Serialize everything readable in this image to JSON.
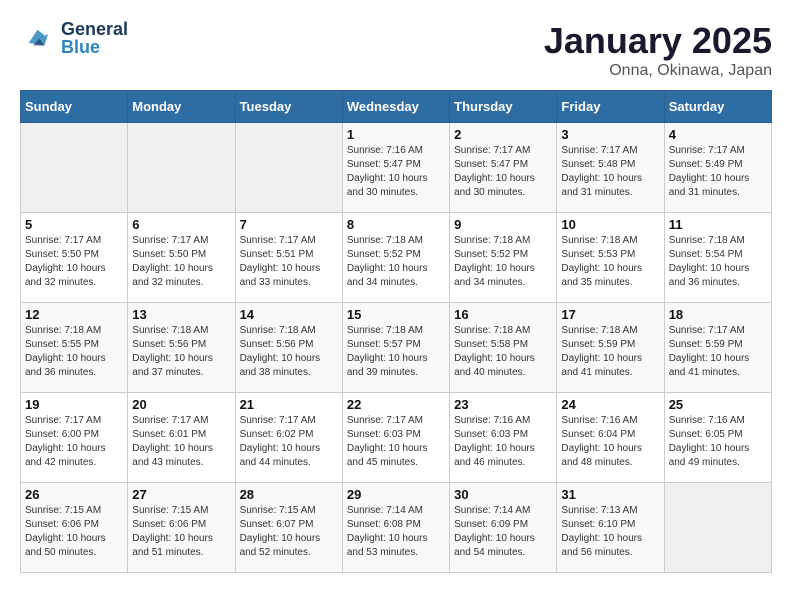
{
  "header": {
    "logo_general": "General",
    "logo_blue": "Blue",
    "title": "January 2025",
    "subtitle": "Onna, Okinawa, Japan"
  },
  "weekdays": [
    "Sunday",
    "Monday",
    "Tuesday",
    "Wednesday",
    "Thursday",
    "Friday",
    "Saturday"
  ],
  "weeks": [
    [
      {
        "day": "",
        "sunrise": "",
        "sunset": "",
        "daylight": "",
        "empty": true
      },
      {
        "day": "",
        "sunrise": "",
        "sunset": "",
        "daylight": "",
        "empty": true
      },
      {
        "day": "",
        "sunrise": "",
        "sunset": "",
        "daylight": "",
        "empty": true
      },
      {
        "day": "1",
        "sunrise": "Sunrise: 7:16 AM",
        "sunset": "Sunset: 5:47 PM",
        "daylight": "Daylight: 10 hours and 30 minutes."
      },
      {
        "day": "2",
        "sunrise": "Sunrise: 7:17 AM",
        "sunset": "Sunset: 5:47 PM",
        "daylight": "Daylight: 10 hours and 30 minutes."
      },
      {
        "day": "3",
        "sunrise": "Sunrise: 7:17 AM",
        "sunset": "Sunset: 5:48 PM",
        "daylight": "Daylight: 10 hours and 31 minutes."
      },
      {
        "day": "4",
        "sunrise": "Sunrise: 7:17 AM",
        "sunset": "Sunset: 5:49 PM",
        "daylight": "Daylight: 10 hours and 31 minutes."
      }
    ],
    [
      {
        "day": "5",
        "sunrise": "Sunrise: 7:17 AM",
        "sunset": "Sunset: 5:50 PM",
        "daylight": "Daylight: 10 hours and 32 minutes."
      },
      {
        "day": "6",
        "sunrise": "Sunrise: 7:17 AM",
        "sunset": "Sunset: 5:50 PM",
        "daylight": "Daylight: 10 hours and 32 minutes."
      },
      {
        "day": "7",
        "sunrise": "Sunrise: 7:17 AM",
        "sunset": "Sunset: 5:51 PM",
        "daylight": "Daylight: 10 hours and 33 minutes."
      },
      {
        "day": "8",
        "sunrise": "Sunrise: 7:18 AM",
        "sunset": "Sunset: 5:52 PM",
        "daylight": "Daylight: 10 hours and 34 minutes."
      },
      {
        "day": "9",
        "sunrise": "Sunrise: 7:18 AM",
        "sunset": "Sunset: 5:52 PM",
        "daylight": "Daylight: 10 hours and 34 minutes."
      },
      {
        "day": "10",
        "sunrise": "Sunrise: 7:18 AM",
        "sunset": "Sunset: 5:53 PM",
        "daylight": "Daylight: 10 hours and 35 minutes."
      },
      {
        "day": "11",
        "sunrise": "Sunrise: 7:18 AM",
        "sunset": "Sunset: 5:54 PM",
        "daylight": "Daylight: 10 hours and 36 minutes."
      }
    ],
    [
      {
        "day": "12",
        "sunrise": "Sunrise: 7:18 AM",
        "sunset": "Sunset: 5:55 PM",
        "daylight": "Daylight: 10 hours and 36 minutes."
      },
      {
        "day": "13",
        "sunrise": "Sunrise: 7:18 AM",
        "sunset": "Sunset: 5:56 PM",
        "daylight": "Daylight: 10 hours and 37 minutes."
      },
      {
        "day": "14",
        "sunrise": "Sunrise: 7:18 AM",
        "sunset": "Sunset: 5:56 PM",
        "daylight": "Daylight: 10 hours and 38 minutes."
      },
      {
        "day": "15",
        "sunrise": "Sunrise: 7:18 AM",
        "sunset": "Sunset: 5:57 PM",
        "daylight": "Daylight: 10 hours and 39 minutes."
      },
      {
        "day": "16",
        "sunrise": "Sunrise: 7:18 AM",
        "sunset": "Sunset: 5:58 PM",
        "daylight": "Daylight: 10 hours and 40 minutes."
      },
      {
        "day": "17",
        "sunrise": "Sunrise: 7:18 AM",
        "sunset": "Sunset: 5:59 PM",
        "daylight": "Daylight: 10 hours and 41 minutes."
      },
      {
        "day": "18",
        "sunrise": "Sunrise: 7:17 AM",
        "sunset": "Sunset: 5:59 PM",
        "daylight": "Daylight: 10 hours and 41 minutes."
      }
    ],
    [
      {
        "day": "19",
        "sunrise": "Sunrise: 7:17 AM",
        "sunset": "Sunset: 6:00 PM",
        "daylight": "Daylight: 10 hours and 42 minutes."
      },
      {
        "day": "20",
        "sunrise": "Sunrise: 7:17 AM",
        "sunset": "Sunset: 6:01 PM",
        "daylight": "Daylight: 10 hours and 43 minutes."
      },
      {
        "day": "21",
        "sunrise": "Sunrise: 7:17 AM",
        "sunset": "Sunset: 6:02 PM",
        "daylight": "Daylight: 10 hours and 44 minutes."
      },
      {
        "day": "22",
        "sunrise": "Sunrise: 7:17 AM",
        "sunset": "Sunset: 6:03 PM",
        "daylight": "Daylight: 10 hours and 45 minutes."
      },
      {
        "day": "23",
        "sunrise": "Sunrise: 7:16 AM",
        "sunset": "Sunset: 6:03 PM",
        "daylight": "Daylight: 10 hours and 46 minutes."
      },
      {
        "day": "24",
        "sunrise": "Sunrise: 7:16 AM",
        "sunset": "Sunset: 6:04 PM",
        "daylight": "Daylight: 10 hours and 48 minutes."
      },
      {
        "day": "25",
        "sunrise": "Sunrise: 7:16 AM",
        "sunset": "Sunset: 6:05 PM",
        "daylight": "Daylight: 10 hours and 49 minutes."
      }
    ],
    [
      {
        "day": "26",
        "sunrise": "Sunrise: 7:15 AM",
        "sunset": "Sunset: 6:06 PM",
        "daylight": "Daylight: 10 hours and 50 minutes."
      },
      {
        "day": "27",
        "sunrise": "Sunrise: 7:15 AM",
        "sunset": "Sunset: 6:06 PM",
        "daylight": "Daylight: 10 hours and 51 minutes."
      },
      {
        "day": "28",
        "sunrise": "Sunrise: 7:15 AM",
        "sunset": "Sunset: 6:07 PM",
        "daylight": "Daylight: 10 hours and 52 minutes."
      },
      {
        "day": "29",
        "sunrise": "Sunrise: 7:14 AM",
        "sunset": "Sunset: 6:08 PM",
        "daylight": "Daylight: 10 hours and 53 minutes."
      },
      {
        "day": "30",
        "sunrise": "Sunrise: 7:14 AM",
        "sunset": "Sunset: 6:09 PM",
        "daylight": "Daylight: 10 hours and 54 minutes."
      },
      {
        "day": "31",
        "sunrise": "Sunrise: 7:13 AM",
        "sunset": "Sunset: 6:10 PM",
        "daylight": "Daylight: 10 hours and 56 minutes."
      },
      {
        "day": "",
        "sunrise": "",
        "sunset": "",
        "daylight": "",
        "empty": true
      }
    ]
  ]
}
